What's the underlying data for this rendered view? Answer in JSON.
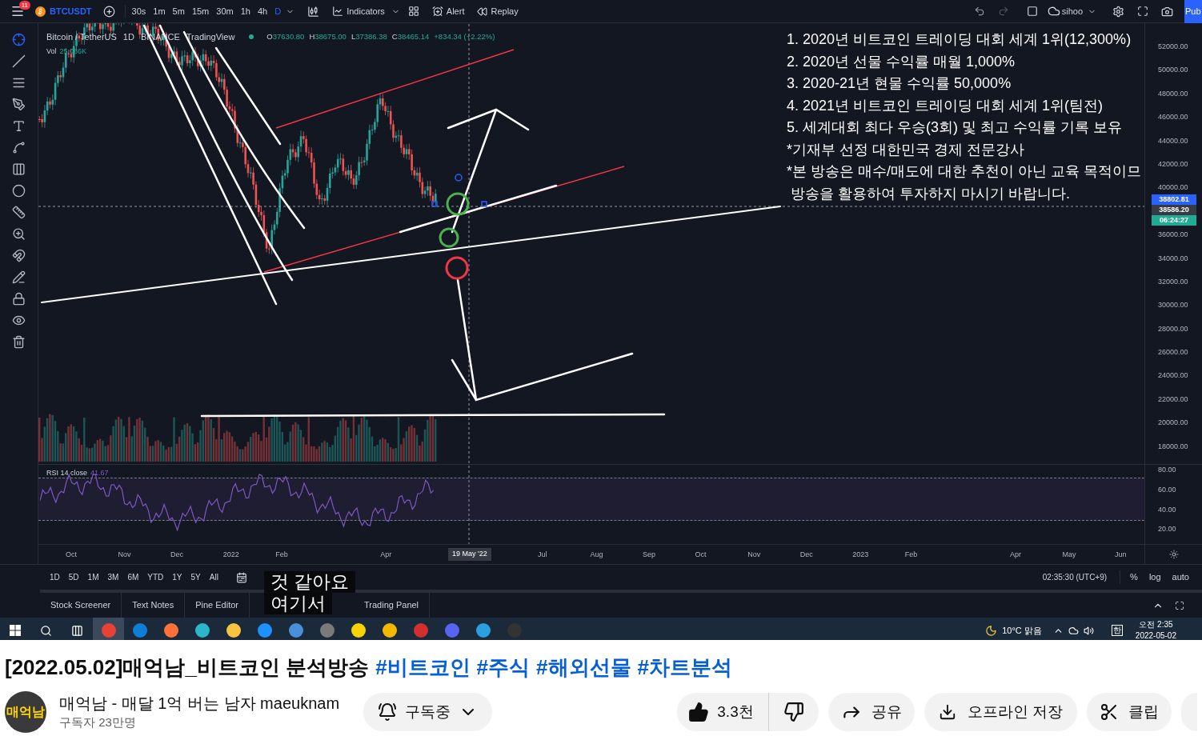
{
  "toolbar": {
    "notification_count": "11",
    "symbol": "BTCUSDT",
    "intervals": [
      {
        "label": "30s",
        "selected": false
      },
      {
        "label": "1m",
        "selected": false
      },
      {
        "label": "5m",
        "selected": false
      },
      {
        "label": "15m",
        "selected": false
      },
      {
        "label": "30m",
        "selected": false
      },
      {
        "label": "1h",
        "selected": false
      },
      {
        "label": "4h",
        "selected": false
      },
      {
        "label": "D",
        "selected": true
      }
    ],
    "indicators": "Indicators",
    "alert": "Alert",
    "replay": "Replay",
    "user": "sihoo",
    "publish": "Pub"
  },
  "legend": {
    "parts": [
      "Bitcoin / TetherUS",
      "1D",
      "BINANCE",
      "TradingView"
    ],
    "ohlc": [
      {
        "label": "O",
        "value": "37630.80"
      },
      {
        "label": "H",
        "value": "38675.00"
      },
      {
        "label": "L",
        "value": "37386.38"
      },
      {
        "label": "C",
        "value": "38465.14"
      }
    ],
    "change": "+834.34 (+2.22%)",
    "volume_label": "Vol",
    "volume_value": "25.086K"
  },
  "overlay_lines": [
    "1. 2020년 비트코인 트레이딩 대회 세계 1위(12,300%)",
    "2. 2020년 선물 수익률 매월 1,000%",
    "3. 2020-21년 현물 수익률 50,000%",
    "4. 2021년 비트코인 트레이딩 대회 세계 1위(팀전)",
    "5. 세계대회 최다 우승(3회) 및 최고 수익률 기록 보유",
    "*기재부 선정 대한민국 경제 전문강사",
    "*본 방송은 매수/매도에 대한 추천이 아닌 교육 목적이므",
    " 방송을 활용하여 투자하지 마시기 바랍니다."
  ],
  "price_axis": [
    "52000.00",
    "50000.00",
    "48000.00",
    "46000.00",
    "44000.00",
    "42000.00",
    "40000.00",
    "36000.00",
    "34000.00",
    "32000.00",
    "30000.00",
    "28000.00",
    "26000.00",
    "24000.00",
    "22000.00",
    "20000.00",
    "18000.00"
  ],
  "price_tags": [
    {
      "text": "38802.81",
      "color": "#2962ff"
    },
    {
      "text": "38586.20",
      "color": "#363a45"
    },
    {
      "text": "06:24:27",
      "color": "#22ab94"
    }
  ],
  "rsi": {
    "label": "RSI 14 close",
    "value": "41.67",
    "ticks": [
      "80.00",
      "60.00",
      "40.00",
      "20.00"
    ]
  },
  "time_axis": [
    "Oct",
    "Nov",
    "Dec",
    "2022",
    "Feb",
    "Apr",
    "Jul",
    "Aug",
    "Sep",
    "Oct",
    "Nov",
    "Dec",
    "2023",
    "Feb",
    "Apr",
    "May",
    "Jun"
  ],
  "cursor_date": "19 May '22",
  "ranges": [
    "1D",
    "5D",
    "1M",
    "3M",
    "6M",
    "YTD",
    "1Y",
    "5Y",
    "All"
  ],
  "clock": "02:35:30 (UTC+9)",
  "scale_options": [
    "%",
    "log",
    "auto"
  ],
  "panel_tabs": [
    "Stock Screener",
    "Text Notes",
    "Pine Editor",
    "Trading Panel"
  ],
  "subtitles": [
    "것 같아요",
    "여기서"
  ],
  "taskbar": {
    "weather": "10°C 맑음",
    "ime": "한",
    "time": "오전 2:35",
    "date": "2022-05-02"
  },
  "video": {
    "title": "[2022.05.02]매억남_비트코인 분석방송",
    "hashtags": [
      "#비트코인",
      "#주식",
      "#해외선물",
      "#차트분석"
    ]
  },
  "channel": {
    "avatar_text": "매억남",
    "name": "매억남 - 매달 1억 버는 남자 maeuknam",
    "subscribers": "구독자 23만명",
    "subscribe": "구독중"
  },
  "actions": {
    "likes": "3.3천",
    "share": "공유",
    "download": "오프라인 저장",
    "clip": "클립"
  }
}
